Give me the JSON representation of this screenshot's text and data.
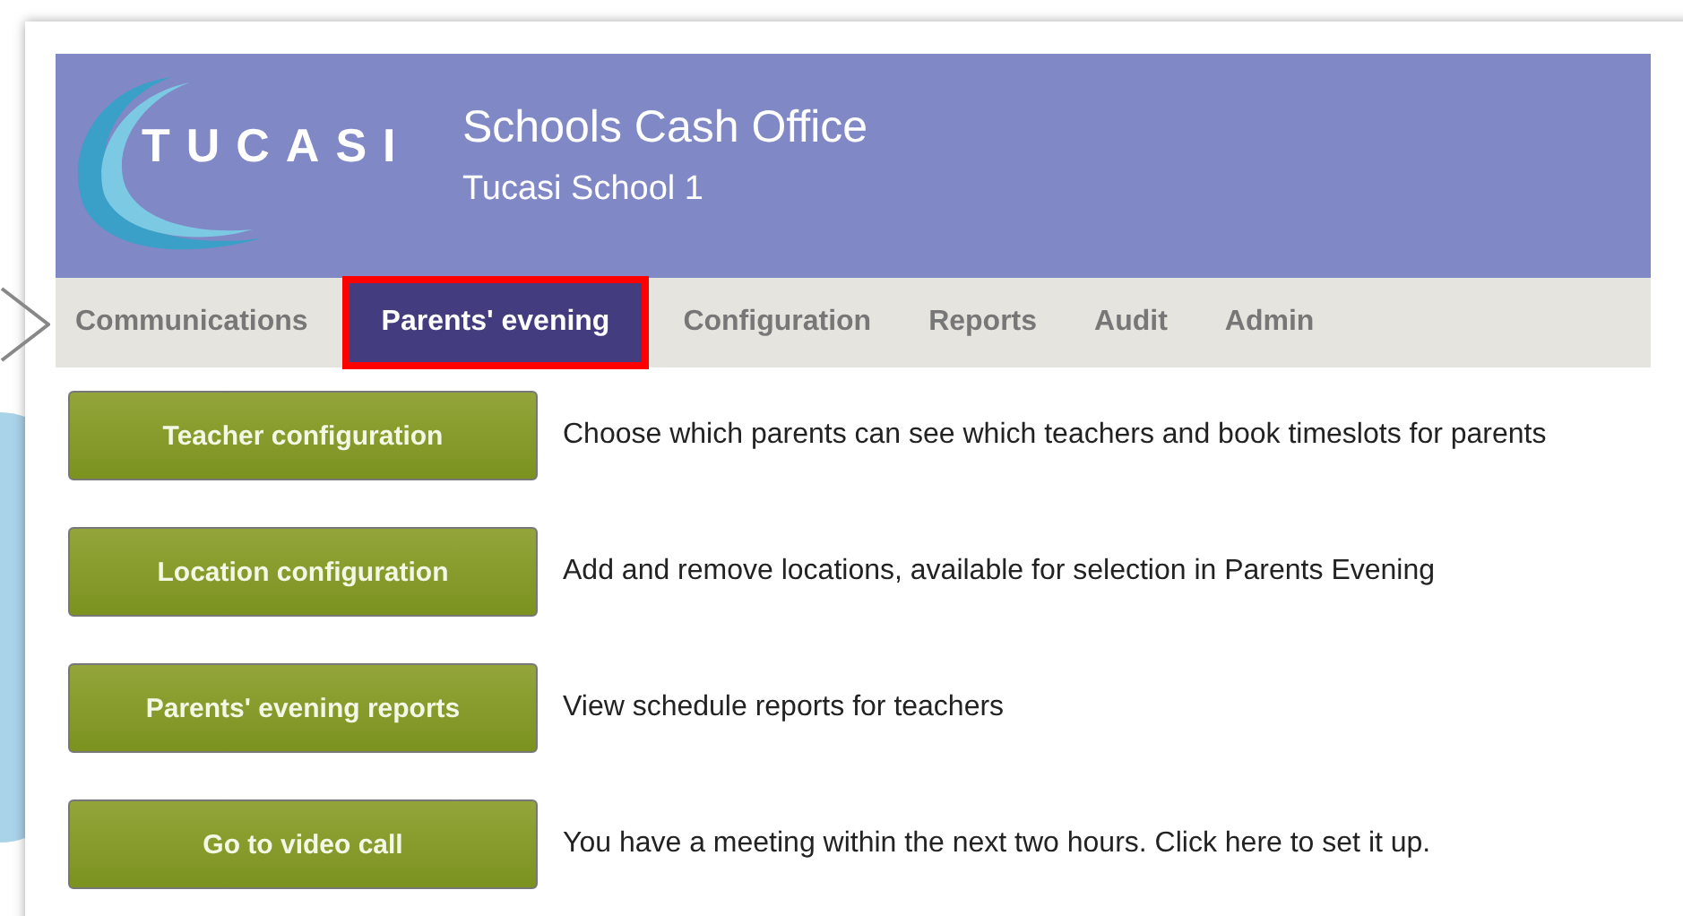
{
  "header": {
    "logo": "TUCASI",
    "title": "Schools Cash Office",
    "subtitle": "Tucasi School 1"
  },
  "tabs": [
    {
      "label": "Communications",
      "selected": false,
      "highlighted": false
    },
    {
      "label": "Parents' evening",
      "selected": true,
      "highlighted": true
    },
    {
      "label": "Configuration",
      "selected": false,
      "highlighted": false
    },
    {
      "label": "Reports",
      "selected": false,
      "highlighted": false
    },
    {
      "label": "Audit",
      "selected": false,
      "highlighted": false
    },
    {
      "label": "Admin",
      "selected": false,
      "highlighted": false
    }
  ],
  "actions": [
    {
      "button": "Teacher configuration",
      "description": "Choose which parents can see which teachers and book timeslots for parents"
    },
    {
      "button": "Location configuration",
      "description": "Add and remove locations, available for selection in Parents Evening"
    },
    {
      "button": "Parents' evening reports",
      "description": "View schedule reports for teachers"
    },
    {
      "button": "Go to video call",
      "description": "You have a meeting within the next two hours. Click here to set it up."
    }
  ]
}
